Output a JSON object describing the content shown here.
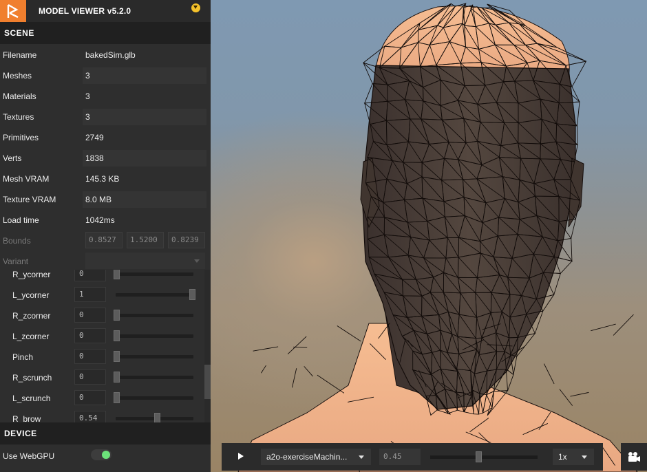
{
  "app": {
    "title": "MODEL VIEWER v5.2.0"
  },
  "scene": {
    "header": "SCENE",
    "rows": [
      {
        "label": "Filename",
        "value": "bakedSim.glb"
      },
      {
        "label": "Meshes",
        "value": "3"
      },
      {
        "label": "Materials",
        "value": "3"
      },
      {
        "label": "Textures",
        "value": "3"
      },
      {
        "label": "Primitives",
        "value": "2749"
      },
      {
        "label": "Verts",
        "value": "1838"
      },
      {
        "label": "Mesh VRAM",
        "value": "145.3 KB"
      },
      {
        "label": "Texture VRAM",
        "value": "8.0 MB"
      },
      {
        "label": "Load time",
        "value": "1042ms"
      }
    ],
    "bounds": {
      "label": "Bounds",
      "values": [
        "0.8527",
        "1.5200",
        "0.8239"
      ]
    },
    "variant": {
      "label": "Variant",
      "value": ""
    }
  },
  "morphs": [
    {
      "label": "R_ycorner",
      "value": "0",
      "level": 0
    },
    {
      "label": "L_ycorner",
      "value": "1",
      "level": 1
    },
    {
      "label": "R_zcorner",
      "value": "0",
      "level": 0
    },
    {
      "label": "L_zcorner",
      "value": "0",
      "level": 0
    },
    {
      "label": "Pinch",
      "value": "0",
      "level": 0
    },
    {
      "label": "R_scrunch",
      "value": "0",
      "level": 0
    },
    {
      "label": "L_scrunch",
      "value": "0",
      "level": 0
    },
    {
      "label": "R_brow",
      "value": "0.54",
      "level": 0.54
    }
  ],
  "device": {
    "header": "DEVICE",
    "webgpu_label": "Use WebGPU",
    "webgpu_enabled": true
  },
  "animation": {
    "selected": "a2o-exerciseMachin...",
    "time": "0.45",
    "progress": 0.45,
    "speed": "1x"
  },
  "colors": {
    "accent": "#f07f2e",
    "toggle_on": "#6ce37a",
    "collapse_button": "#f5c22b",
    "skin": "#f2b48c",
    "wire_face": "#4a3f3b"
  },
  "icons": {
    "logo": "playcanvas-logo-icon",
    "collapse": "chevron-down-icon",
    "play": "play-icon",
    "camera": "camera-icon"
  }
}
